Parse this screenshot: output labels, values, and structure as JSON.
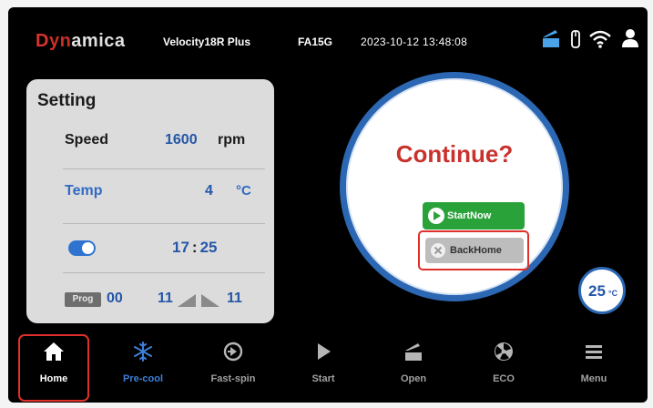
{
  "topbar": {
    "brand": "Dynamica",
    "model": "Velocity18R Plus",
    "rotor": "FA15G",
    "datetime": "2023-10-12  13:48:08",
    "status_icons": [
      "lid-icon",
      "usb-icon",
      "wifi-icon",
      "user-icon"
    ]
  },
  "setting": {
    "title": "Setting",
    "speed": {
      "label": "Speed",
      "value": "1600",
      "unit": "rpm"
    },
    "temp": {
      "label": "Temp",
      "value": "4",
      "unit": "°C"
    },
    "timer": {
      "toggle_on": true,
      "minutes": "17",
      "separator": ":",
      "seconds": "25"
    },
    "program": {
      "badge": "Prog",
      "number": "00",
      "accel": "11",
      "decel": "11"
    }
  },
  "dialog": {
    "title": "Continue?",
    "start_now": "StartNow",
    "back_home": "BackHome"
  },
  "chamber_temp": {
    "value": "25",
    "unit": "°C"
  },
  "nav": [
    {
      "label": "Home",
      "icon": "home-icon"
    },
    {
      "label": "Pre-cool",
      "icon": "snowflake-icon"
    },
    {
      "label": "Fast-spin",
      "icon": "fast-spin-icon"
    },
    {
      "label": "Start",
      "icon": "play-icon"
    },
    {
      "label": "Open",
      "icon": "open-lid-icon"
    },
    {
      "label": "ECO",
      "icon": "eco-icon"
    },
    {
      "label": "Menu",
      "icon": "menu-icon"
    }
  ],
  "colors": {
    "accent_blue": "#2c67b3",
    "alert_red": "#c8322d",
    "start_green": "#2aa23a"
  }
}
